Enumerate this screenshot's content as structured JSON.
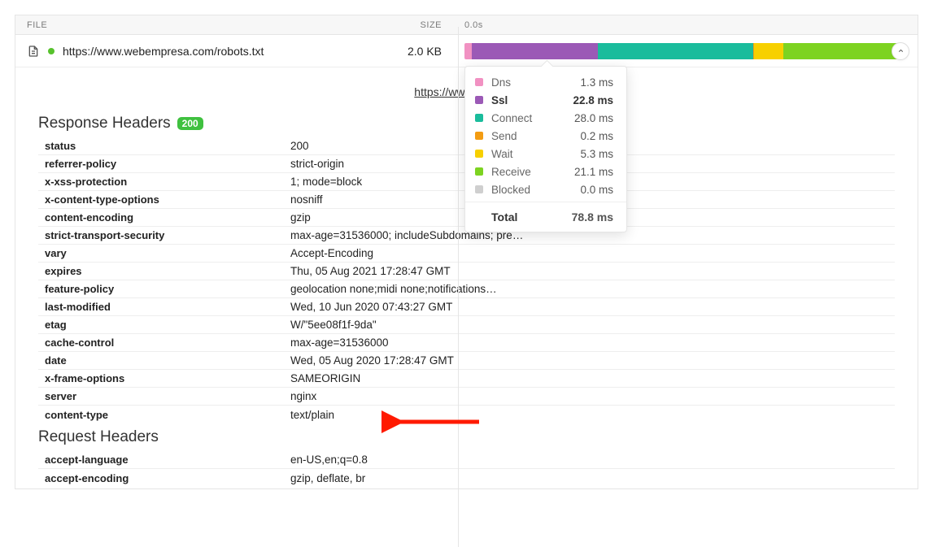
{
  "header": {
    "file_label": "FILE",
    "size_label": "SIZE",
    "waterfall_start": "0.0s"
  },
  "row": {
    "url": "https://www.webempresa.com/robots.txt",
    "size": "2.0 KB",
    "center_link_text": "https://www.webemp",
    "segments": {
      "dns": 1.65,
      "ssl": 28.9,
      "connect": 35.5,
      "send": 0.25,
      "wait": 6.7,
      "receive": 27.0
    }
  },
  "timing": {
    "rows": [
      {
        "color": "#f191c2",
        "name": "Dns",
        "value": "1.3 ms",
        "bold": false
      },
      {
        "color": "#9b59b6",
        "name": "Ssl",
        "value": "22.8 ms",
        "bold": true
      },
      {
        "color": "#1abc9c",
        "name": "Connect",
        "value": "28.0 ms",
        "bold": false
      },
      {
        "color": "#f39c12",
        "name": "Send",
        "value": "0.2 ms",
        "bold": false
      },
      {
        "color": "#f7d000",
        "name": "Wait",
        "value": "5.3 ms",
        "bold": false
      },
      {
        "color": "#7dd321",
        "name": "Receive",
        "value": "21.1 ms",
        "bold": false
      },
      {
        "color": "#cfcfcf",
        "name": "Blocked",
        "value": "0.0 ms",
        "bold": false
      }
    ],
    "total_label": "Total",
    "total_value": "78.8 ms"
  },
  "response": {
    "title": "Response Headers",
    "badge": "200",
    "items": [
      {
        "k": "status",
        "v": "200"
      },
      {
        "k": "referrer-policy",
        "v": "strict-origin"
      },
      {
        "k": "x-xss-protection",
        "v": "1; mode=block"
      },
      {
        "k": "x-content-type-options",
        "v": "nosniff"
      },
      {
        "k": "content-encoding",
        "v": "gzip"
      },
      {
        "k": "strict-transport-security",
        "v": "max-age=31536000; includeSubdomains; pre…"
      },
      {
        "k": "vary",
        "v": "Accept-Encoding"
      },
      {
        "k": "expires",
        "v": "Thu, 05 Aug 2021 17:28:47 GMT"
      },
      {
        "k": "feature-policy",
        "v": "geolocation none;midi none;notifications…"
      },
      {
        "k": "last-modified",
        "v": "Wed, 10 Jun 2020 07:43:27 GMT"
      },
      {
        "k": "etag",
        "v": "W/\"5ee08f1f-9da\""
      },
      {
        "k": "cache-control",
        "v": "max-age=31536000"
      },
      {
        "k": "date",
        "v": "Wed, 05 Aug 2020 17:28:47 GMT"
      },
      {
        "k": "x-frame-options",
        "v": "SAMEORIGIN"
      },
      {
        "k": "server",
        "v": "nginx"
      },
      {
        "k": "content-type",
        "v": "text/plain"
      }
    ]
  },
  "request": {
    "title": "Request Headers",
    "items": [
      {
        "k": "accept-language",
        "v": "en-US,en;q=0.8"
      },
      {
        "k": "accept-encoding",
        "v": "gzip, deflate, br"
      }
    ]
  }
}
